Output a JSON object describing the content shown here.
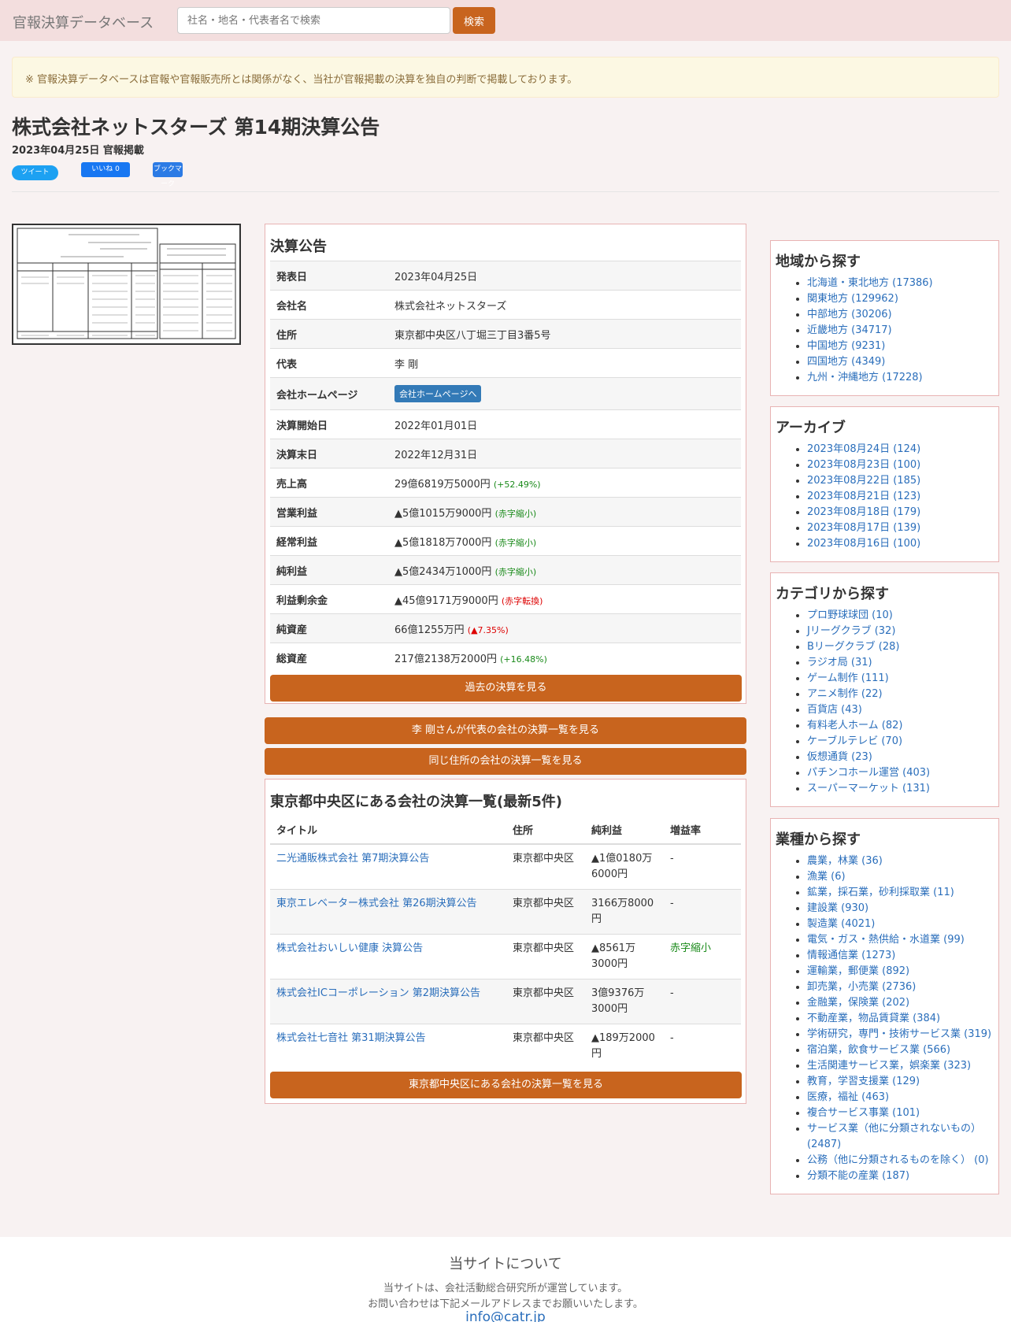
{
  "nav": {
    "brand": "官報決算データベース",
    "search_placeholder": "社名・地名・代表者名で検索",
    "search_button": "検索"
  },
  "notice": "※ 官報決算データベースは官報や官報販売所とは関係がなく、当社が官報掲載の決算を独自の判断で掲載しております。",
  "header": {
    "title": "株式会社ネットスターズ 第14期決算公告",
    "date": "2023年04月25日 官報掲載"
  },
  "share": {
    "tweet": "ツイート",
    "like": "いいね 0",
    "hatena": "ブックマーク"
  },
  "info": {
    "heading": "決算公告",
    "publish_label": "発表日",
    "publish": "2023年04月25日",
    "company_label": "会社名",
    "company": "株式会社ネットスターズ",
    "address_label": "住所",
    "address": "東京都中央区八丁堀三丁目3番5号",
    "rep_label": "代表",
    "rep": "李 剛",
    "hp_label": "会社ホームページ",
    "hp_button": "会社ホームページへ",
    "start_label": "決算開始日",
    "start": "2022年01月01日",
    "end_label": "決算末日",
    "end": "2022年12月31日",
    "sales_label": "売上高",
    "sales": "29億6819万5000円",
    "sales_chg": "(+52.49%)",
    "op_label": "営業利益",
    "op": "▲5億1015万9000円",
    "op_chg": "(赤字縮小)",
    "ord_label": "経常利益",
    "ord": "▲5億1818万7000円",
    "ord_chg": "(赤字縮小)",
    "net_label": "純利益",
    "net": "▲5億2434万1000円",
    "net_chg": "(赤字縮小)",
    "re_label": "利益剰余金",
    "re": "▲45億9171万9000円",
    "re_chg": "(赤字転換)",
    "eq_label": "純資産",
    "eq": "66億1255万円",
    "eq_chg": "(▲7.35%)",
    "ta_label": "総資産",
    "ta": "217億2138万2000円",
    "ta_chg": "(+16.48%)",
    "past_button": "過去の決算を見る"
  },
  "buttons": {
    "rep_list": "李 剛さんが代表の会社の決算一覧を見る",
    "same_address": "同じ住所の会社の決算一覧を見る"
  },
  "latest": {
    "heading": "東京都中央区にある会社の決算一覧(最新5件)",
    "cols": {
      "title": "タイトル",
      "address": "住所",
      "net": "純利益",
      "rate": "増益率"
    },
    "rows": [
      {
        "title": "二光通販株式会社 第7期決算公告",
        "address": "東京都中央区",
        "net": "▲1億0180万6000円",
        "rate": "-"
      },
      {
        "title": "東京エレベーター株式会社 第26期決算公告",
        "address": "東京都中央区",
        "net": "3166万8000円",
        "rate": "-"
      },
      {
        "title": "株式会社おいしい健康 決算公告",
        "address": "東京都中央区",
        "net": "▲8561万3000円",
        "rate": "赤字縮小"
      },
      {
        "title": "株式会社ICコーポレーション 第2期決算公告",
        "address": "東京都中央区",
        "net": "3億9376万3000円",
        "rate": "-"
      },
      {
        "title": "株式会社七音社 第31期決算公告",
        "address": "東京都中央区",
        "net": "▲189万2000円",
        "rate": "-"
      }
    ],
    "more_button": "東京都中央区にある会社の決算一覧を見る"
  },
  "sidebar": {
    "region": {
      "heading": "地域から探す",
      "items": [
        "北海道・東北地方 (17386)",
        "関東地方 (129962)",
        "中部地方 (30206)",
        "近畿地方 (34717)",
        "中国地方 (9231)",
        "四国地方 (4349)",
        "九州・沖縄地方 (17228)"
      ]
    },
    "archive": {
      "heading": "アーカイブ",
      "items": [
        "2023年08月24日 (124)",
        "2023年08月23日 (100)",
        "2023年08月22日 (185)",
        "2023年08月21日 (123)",
        "2023年08月18日 (179)",
        "2023年08月17日 (139)",
        "2023年08月16日 (100)"
      ]
    },
    "category": {
      "heading": "カテゴリから探す",
      "items": [
        "プロ野球球団 (10)",
        "Jリーグクラブ (32)",
        "Bリーグクラブ (28)",
        "ラジオ局 (31)",
        "ゲーム制作 (111)",
        "アニメ制作 (22)",
        "百貨店 (43)",
        "有料老人ホーム (82)",
        "ケーブルテレビ (70)",
        "仮想通貨 (23)",
        "パチンコホール運営 (403)",
        "スーパーマーケット (131)"
      ]
    },
    "industry": {
      "heading": "業種から探す",
      "items": [
        "農業，林業 (36)",
        "漁業 (6)",
        "鉱業，採石業，砂利採取業 (11)",
        "建設業 (930)",
        "製造業 (4021)",
        "電気・ガス・熱供給・水道業 (99)",
        "情報通信業 (1273)",
        "運輸業，郵便業 (892)",
        "卸売業，小売業 (2736)",
        "金融業，保険業 (202)",
        "不動産業，物品賃貸業 (384)",
        "学術研究，専門・技術サービス業 (319)",
        "宿泊業，飲食サービス業 (566)",
        "生活関連サービス業，娯楽業 (323)",
        "教育，学習支援業 (129)",
        "医療，福祉 (463)",
        "複合サービス事業 (101)",
        "サービス業（他に分類されないもの） (2487)",
        "公務（他に分類されるものを除く） (0)",
        "分類不能の産業 (187)"
      ]
    }
  },
  "footer": {
    "title": "当サイトについて",
    "line1": "当サイトは、会社活動総合研究所が運営しています。",
    "line2": "お問い合わせは下記メールアドレスまでお願いいたします。",
    "email": "info@catr.jp"
  }
}
